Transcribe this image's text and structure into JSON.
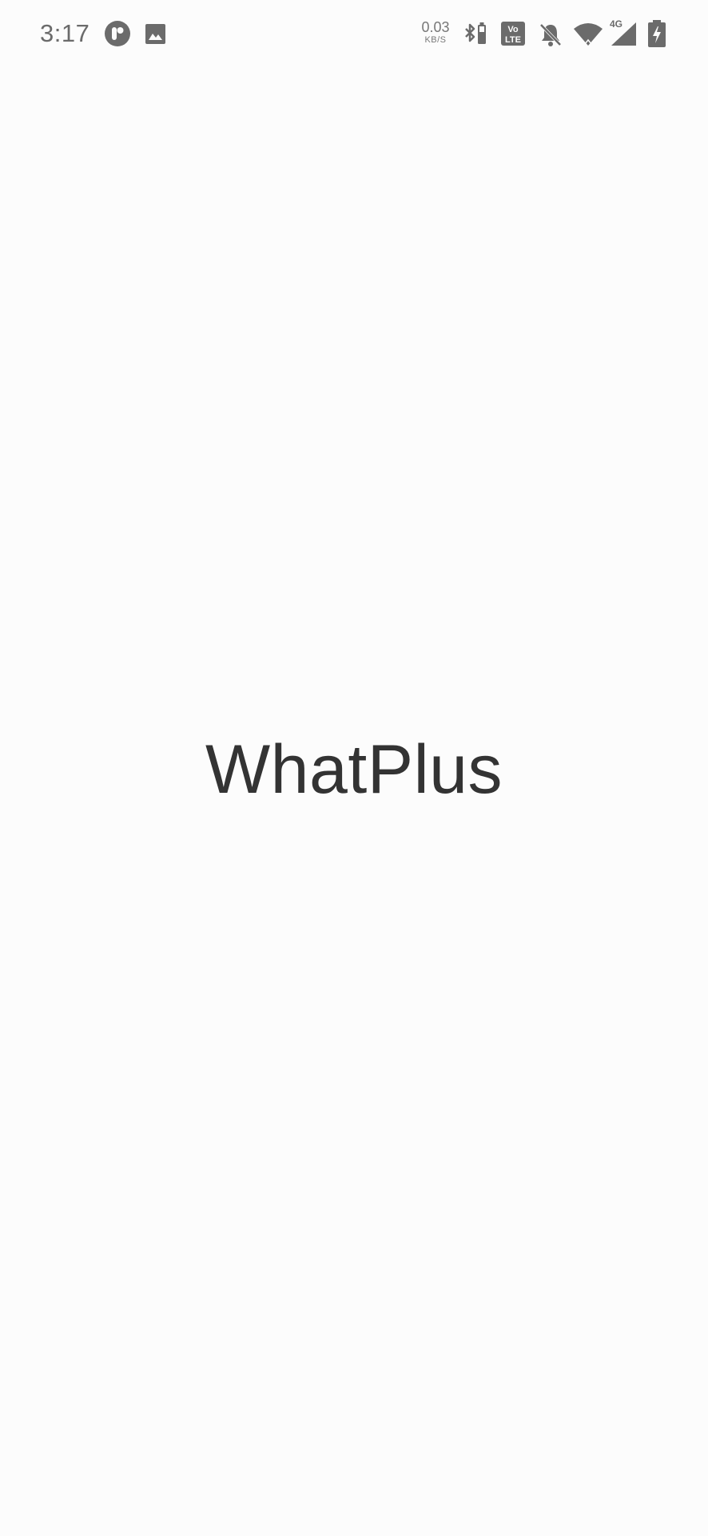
{
  "status_bar": {
    "time": "3:17",
    "network_speed": {
      "value": "0.03",
      "unit": "KB/S"
    },
    "volte_label": "Vo LTE",
    "network_type": "4G",
    "icons": [
      "assistant-app-icon",
      "gallery-icon",
      "bluetooth-icon",
      "volte-icon",
      "notifications-off-icon",
      "wifi-icon",
      "signal-icon",
      "battery-charging-icon"
    ]
  },
  "splash": {
    "title": "WhatPlus"
  },
  "colors": {
    "background": "#fcfcfc",
    "status_icons": "#6b6b6b",
    "title_text": "#333333"
  }
}
